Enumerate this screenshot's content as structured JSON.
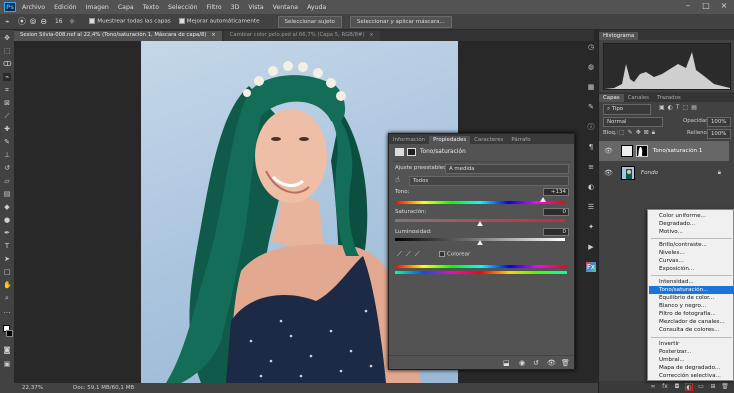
{
  "menubar": {
    "items": [
      "Archivo",
      "Edición",
      "Imagen",
      "Capa",
      "Texto",
      "Selección",
      "Filtro",
      "3D",
      "Vista",
      "Ventana",
      "Ayuda"
    ]
  },
  "options": {
    "size": "16",
    "sample_all": "Muestrear todas las capas",
    "auto_enhance": "Mejorar automáticamente",
    "select_subject": "Seleccionar sujeto",
    "select_mask": "Seleccionar y aplicar máscara..."
  },
  "tabs": [
    {
      "label": "Sesion Silvia-008.nef al 22,4% (Tono/saturación 1, Máscara de capa/8)",
      "close": "×"
    },
    {
      "label": "Cambiar color pelo.psd al 66,7% (Capa 5, RGB/8#)",
      "close": "×"
    }
  ],
  "status": {
    "zoom": "22,37%",
    "doc": "Doc: 59,1 MB/60,1 MB"
  },
  "histogram": {
    "tab": "Histograma"
  },
  "layers": {
    "tabs": [
      "Capas",
      "Canales",
      "Trazados"
    ],
    "kind_filter": "Tipo",
    "blend_mode": "Normal",
    "opacity_label": "Opacidad:",
    "opacity": "100%",
    "lock_label": "Bloq.:",
    "fill_label": "Relleno:",
    "fill": "100%",
    "rows": [
      {
        "name": "Tono/saturación 1"
      },
      {
        "name": "Fondo"
      }
    ]
  },
  "properties": {
    "tabs": [
      "Información",
      "Propiedades",
      "Caracteres",
      "Párrafo"
    ],
    "title": "Tono/saturación",
    "preset_label": "Ajuste preestablecido:",
    "preset_value": "A medida",
    "channel": "Todos",
    "hue_label": "Tono:",
    "hue_value": "+134",
    "hue": 134,
    "saturation_label": "Saturación:",
    "saturation_value": "0",
    "saturation": 0,
    "lightness_label": "Luminosidad:",
    "lightness_value": "0",
    "lightness": 0,
    "colorize_label": "Colorear"
  },
  "adjust_menu": {
    "groups": [
      [
        "Color uniforme...",
        "Degradado...",
        "Motivo..."
      ],
      [
        "Brillo/contraste...",
        "Niveles...",
        "Curvas...",
        "Exposición..."
      ],
      [
        "Intensidad...",
        "Tono/saturación...",
        "Equilibrio de color...",
        "Blanco y negro...",
        "Filtro de fotografía...",
        "Mezclador de canales...",
        "Consulta de colores..."
      ],
      [
        "Invertir",
        "Posterizar...",
        "Umbral...",
        "Mapa de degradado...",
        "Corrección selectiva..."
      ]
    ],
    "selected": "Tono/saturación..."
  },
  "colors": {
    "accent": "#1e73d8",
    "hair": "#0f5a48",
    "dress": "#1c2a45",
    "bg_blue": "#aac4de"
  }
}
